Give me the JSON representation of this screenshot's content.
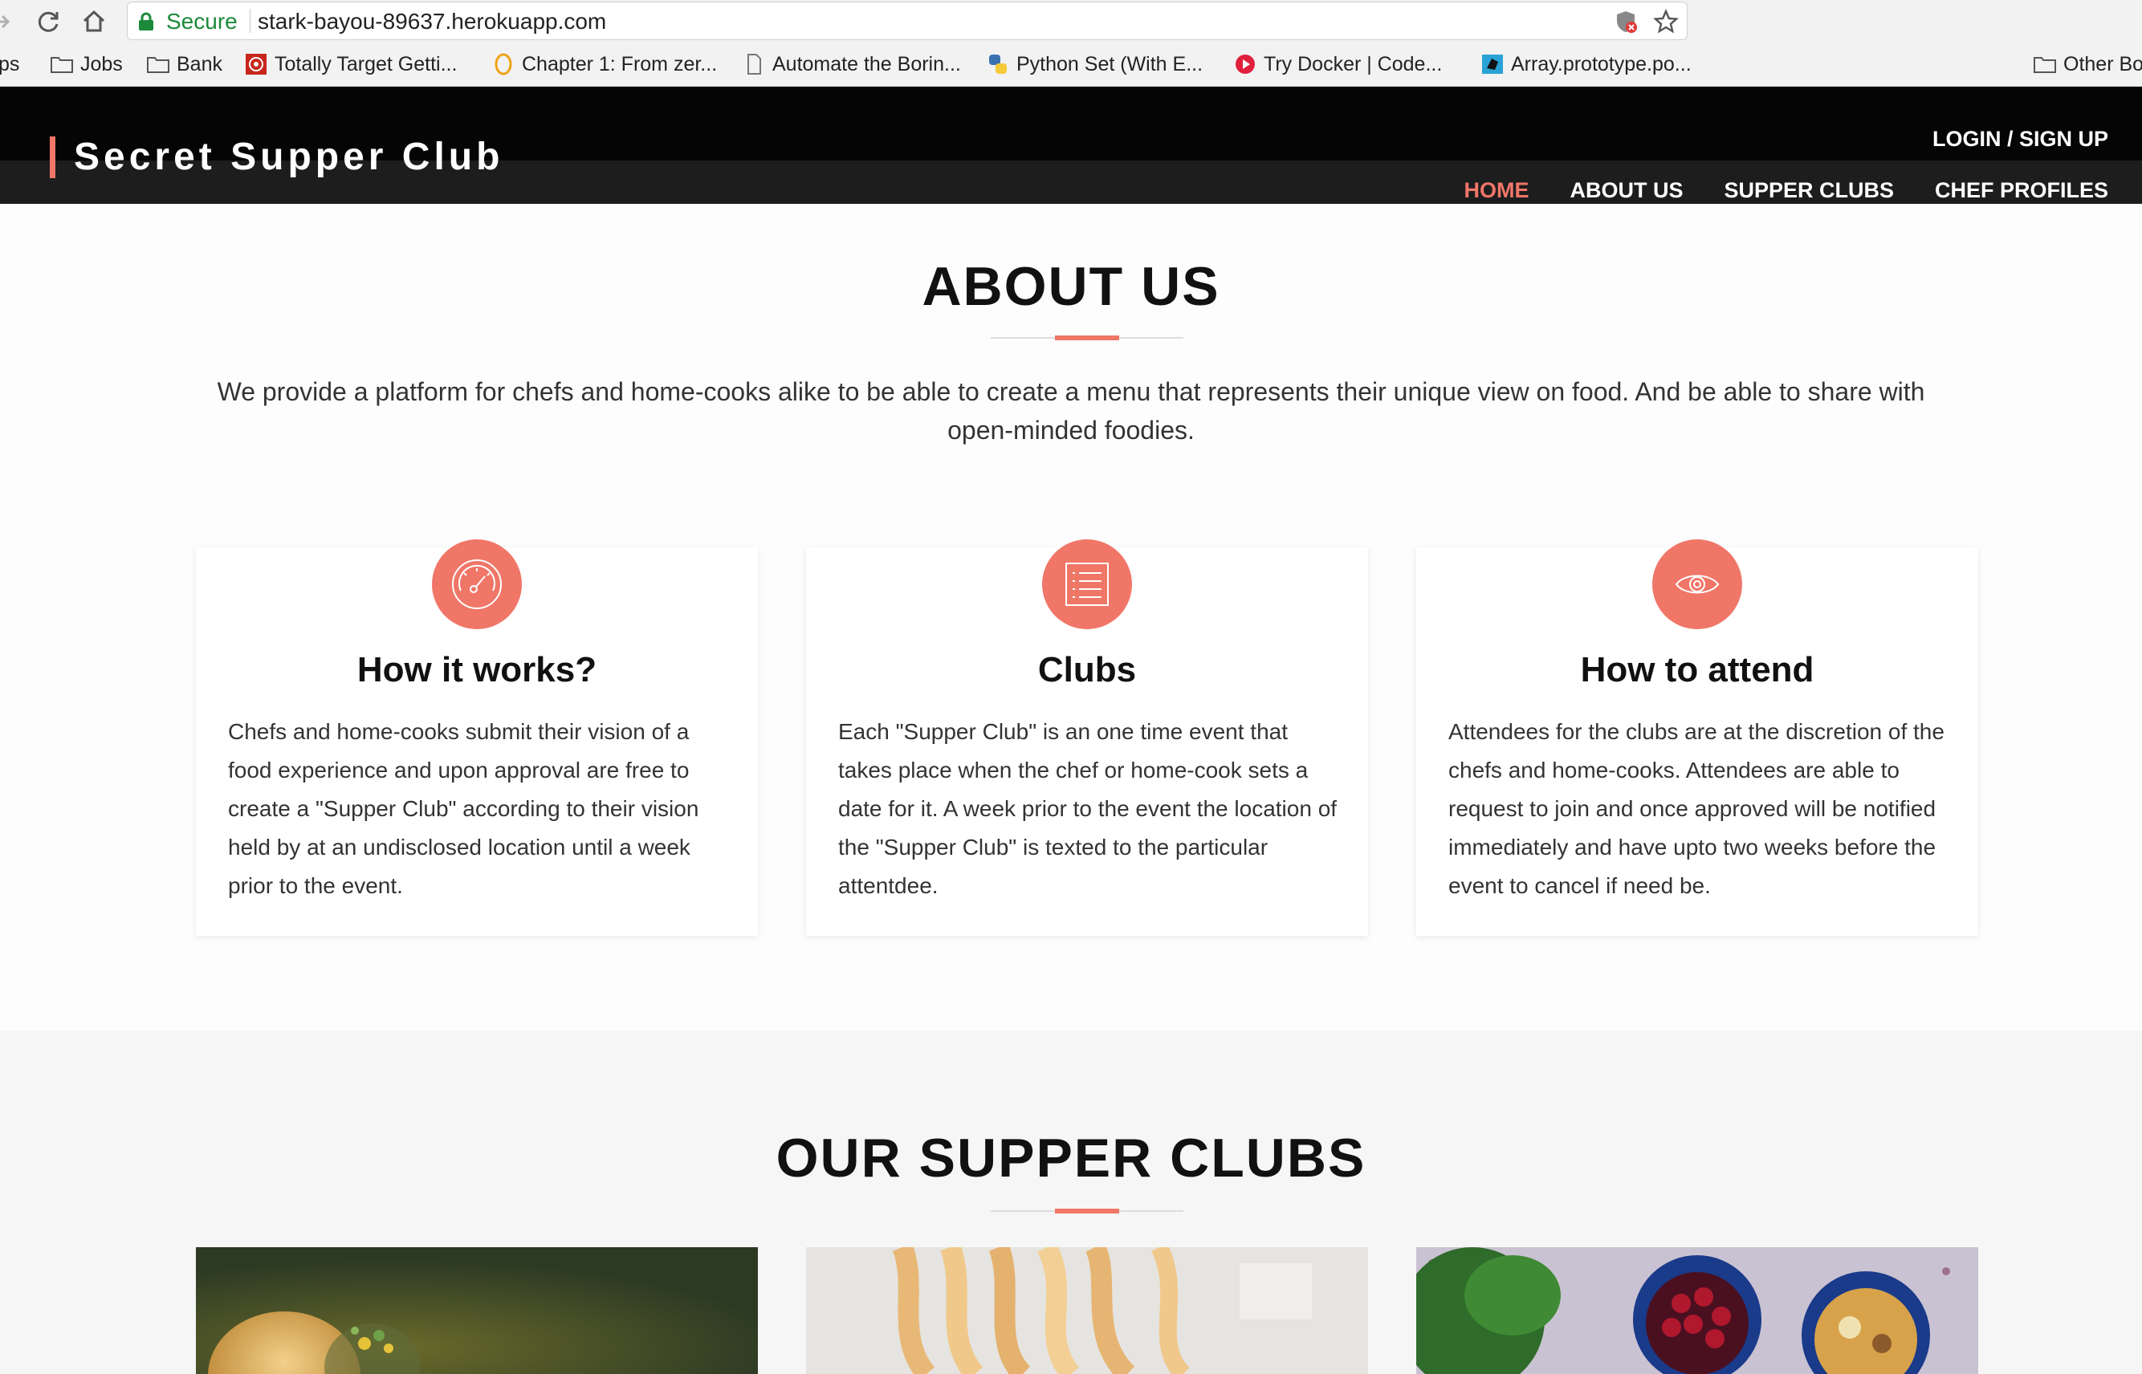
{
  "browser": {
    "secure_label": "Secure",
    "url": "stark-bayou-89637.herokuapp.com",
    "bookmarks": [
      {
        "label": "ps"
      },
      {
        "label": "Jobs"
      },
      {
        "label": "Bank"
      },
      {
        "label": "Totally Target Getti..."
      },
      {
        "label": "Chapter 1: From zer..."
      },
      {
        "label": "Automate the Borin..."
      },
      {
        "label": "Python Set (With E..."
      },
      {
        "label": "Try Docker | Code..."
      },
      {
        "label": "Array.prototype.po..."
      },
      {
        "label": "Other Bo"
      }
    ]
  },
  "header": {
    "brand": "Secret Supper Club",
    "login": "LOGIN / SIGN UP",
    "nav": [
      "HOME",
      "ABOUT US",
      "SUPPER CLUBS",
      "CHEF PROFILES"
    ],
    "active_nav": "HOME"
  },
  "about": {
    "title": "ABOUT US",
    "description": "We provide a platform for chefs and home-cooks alike to be able to create a menu that represents their unique view on food. And be able to share with open-minded foodies.",
    "cards": [
      {
        "icon": "speedometer-icon",
        "title": "How it works?",
        "text": "Chefs and home-cooks submit their vision of a food experience and upon approval are free to create a \"Supper Club\" according to their vision held by at an undisclosed location until a week prior to the event."
      },
      {
        "icon": "list-icon",
        "title": "Clubs",
        "text": "Each \"Supper Club\" is an one time event that takes place when the chef or home-cook sets a date for it. A week prior to the event the location of the \"Supper Club\" is texted to the particular attentdee."
      },
      {
        "icon": "eye-icon",
        "title": "How to attend",
        "text": "Attendees for the clubs are at the discretion of the chefs and home-cooks. Attendees are able to request to join and once approved will be notified immediately and have upto two weeks before the event to cancel if need be."
      }
    ]
  },
  "clubs": {
    "title": "OUR SUPPER CLUBS"
  },
  "colors": {
    "accent": "#f07668",
    "secure_green": "#1c8a3a",
    "header_bg": "#050505"
  }
}
